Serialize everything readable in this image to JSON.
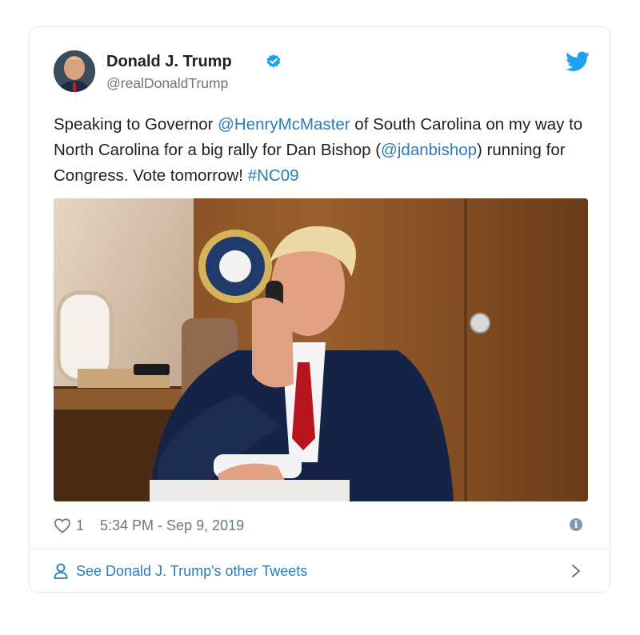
{
  "tweet": {
    "author_name": "Donald J. Trump",
    "author_handle": "@realDonaldTrump",
    "text_parts": [
      {
        "text": "Speaking to Governor ",
        "link": false
      },
      {
        "text": "@HenryMcMaster",
        "link": true
      },
      {
        "text": " of South Carolina on my way to North Carolina for a big rally for Dan Bishop (",
        "link": false
      },
      {
        "text": "@jdanbishop",
        "link": true
      },
      {
        "text": ") running for Congress. Vote tomorrow! ",
        "link": false
      },
      {
        "text": "#NC09",
        "link": true
      }
    ],
    "likes": "1",
    "timestamp": "5:34 PM - Sep 9, 2019"
  },
  "footer": {
    "see_more_label": "See Donald J. Trump's other Tweets"
  },
  "icons": {
    "verified": "verified-badge-icon",
    "brand": "twitter-bird-icon",
    "like": "heart-icon",
    "info": "info-icon",
    "profile": "person-icon",
    "chevron": "chevron-right-icon"
  },
  "colors": {
    "link": "#2b7bb9",
    "verified": "#1da1f2",
    "muted": "#697882",
    "border": "#e1e8ed"
  }
}
